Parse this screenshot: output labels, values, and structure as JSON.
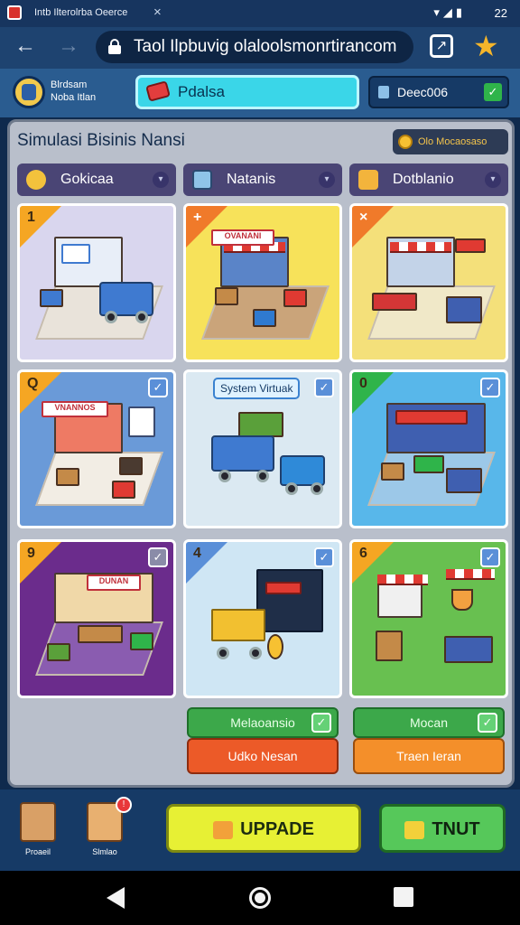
{
  "status_bar": {
    "tab_title": "Intb Ilterolrba Oeerce",
    "tab_close": "×",
    "time": "22"
  },
  "browser": {
    "back_glyph": "←",
    "forward_glyph": "→",
    "url": "Taol Ilpbuvig olaloolsmonrtirancom",
    "share_glyph": "↗",
    "star_glyph": "★"
  },
  "game_header": {
    "player_name_line1": "Blrdsam",
    "player_name_line2": "Noba Itlan",
    "title_pill": "Pdalsa",
    "cash": "Deec006",
    "cash_check": "✓"
  },
  "panel": {
    "title": "Simulasi Bisinis Nansi",
    "bonus": "Olo Mocaosaso",
    "tabs": [
      {
        "label": "Gokicaa",
        "icon_color": "#f3c23c"
      },
      {
        "label": "Natanis",
        "icon_color": "#8fc4e8"
      },
      {
        "label": "Dotblanio",
        "icon_color": "#f3b43c"
      }
    ]
  },
  "cards": [
    {
      "id": "store-office",
      "num": "1",
      "corner_color": "#f5a623",
      "bg": "#d9d6ee",
      "checked": false,
      "sign": "",
      "theme": "#3f7ad0"
    },
    {
      "id": "market-stall",
      "num": "+",
      "corner_color": "#f07a2a",
      "bg": "#f7e25a",
      "checked": false,
      "sign": "OVANANI",
      "theme": "#e03a32"
    },
    {
      "id": "storefront-cart",
      "num": "×",
      "corner_color": "#f07a2a",
      "bg": "#f4e07a",
      "checked": false,
      "sign": "",
      "theme": "#d43636"
    },
    {
      "id": "neon-store",
      "num": "Q",
      "corner_color": "#f5a623",
      "bg": "#6a9ad8",
      "checked": true,
      "sign": "VNANNOS",
      "theme": "#e03a32"
    },
    {
      "id": "delivery-trucks",
      "num": "",
      "corner_color": "",
      "bg": "#dbe9f2",
      "checked": true,
      "sign": "",
      "theme": "#3f7ad0",
      "badge": "System Virtuak"
    },
    {
      "id": "shop-interior",
      "num": "0",
      "corner_color": "#2fb44a",
      "bg": "#58b7ea",
      "checked": true,
      "sign": "",
      "theme": "#3f5fb0"
    },
    {
      "id": "office-showroom",
      "num": "9",
      "corner_color": "#f5a623",
      "bg": "#6b2c8c",
      "checked": true,
      "sign": "DUNAN",
      "theme": "#e03a32"
    },
    {
      "id": "shopping-cart",
      "num": "4",
      "corner_color": "#5a8fd8",
      "bg": "#cfe6f4",
      "checked": true,
      "sign": "",
      "theme": "#f2c030"
    },
    {
      "id": "market-stands",
      "num": "6",
      "corner_color": "#f5a623",
      "bg": "#68c050",
      "checked": true,
      "sign": "",
      "theme": "#e03a32"
    }
  ],
  "status_buttons": [
    {
      "label": "Melaoansio",
      "check": "✓"
    },
    {
      "label": "Mocan",
      "check": "✓"
    }
  ],
  "action_buttons": [
    {
      "label": "Udko Nesan"
    },
    {
      "label": "Traen Ieran"
    }
  ],
  "footer": {
    "item1_label": "Proaeil",
    "item2_label": "Slmlao",
    "item2_badge": "!",
    "upgrade_label": "UPPADE",
    "next_label": "TNUT"
  },
  "colors": {
    "upgrade_button": "#e7f034",
    "next_button": "#56c85a",
    "panel": "#b9bfcb"
  }
}
